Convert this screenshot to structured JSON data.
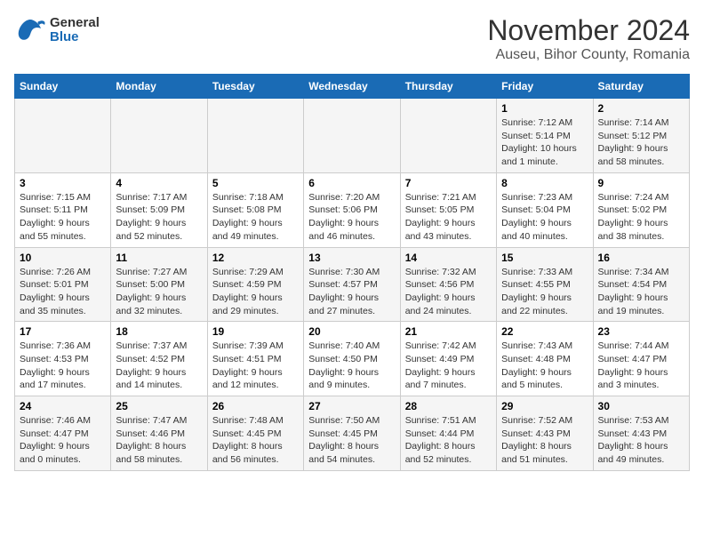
{
  "logo": {
    "line1": "General",
    "line2": "Blue"
  },
  "title": "November 2024",
  "location": "Auseu, Bihor County, Romania",
  "days_of_week": [
    "Sunday",
    "Monday",
    "Tuesday",
    "Wednesday",
    "Thursday",
    "Friday",
    "Saturday"
  ],
  "weeks": [
    [
      {
        "day": "",
        "info": ""
      },
      {
        "day": "",
        "info": ""
      },
      {
        "day": "",
        "info": ""
      },
      {
        "day": "",
        "info": ""
      },
      {
        "day": "",
        "info": ""
      },
      {
        "day": "1",
        "info": "Sunrise: 7:12 AM\nSunset: 5:14 PM\nDaylight: 10 hours and 1 minute."
      },
      {
        "day": "2",
        "info": "Sunrise: 7:14 AM\nSunset: 5:12 PM\nDaylight: 9 hours and 58 minutes."
      }
    ],
    [
      {
        "day": "3",
        "info": "Sunrise: 7:15 AM\nSunset: 5:11 PM\nDaylight: 9 hours and 55 minutes."
      },
      {
        "day": "4",
        "info": "Sunrise: 7:17 AM\nSunset: 5:09 PM\nDaylight: 9 hours and 52 minutes."
      },
      {
        "day": "5",
        "info": "Sunrise: 7:18 AM\nSunset: 5:08 PM\nDaylight: 9 hours and 49 minutes."
      },
      {
        "day": "6",
        "info": "Sunrise: 7:20 AM\nSunset: 5:06 PM\nDaylight: 9 hours and 46 minutes."
      },
      {
        "day": "7",
        "info": "Sunrise: 7:21 AM\nSunset: 5:05 PM\nDaylight: 9 hours and 43 minutes."
      },
      {
        "day": "8",
        "info": "Sunrise: 7:23 AM\nSunset: 5:04 PM\nDaylight: 9 hours and 40 minutes."
      },
      {
        "day": "9",
        "info": "Sunrise: 7:24 AM\nSunset: 5:02 PM\nDaylight: 9 hours and 38 minutes."
      }
    ],
    [
      {
        "day": "10",
        "info": "Sunrise: 7:26 AM\nSunset: 5:01 PM\nDaylight: 9 hours and 35 minutes."
      },
      {
        "day": "11",
        "info": "Sunrise: 7:27 AM\nSunset: 5:00 PM\nDaylight: 9 hours and 32 minutes."
      },
      {
        "day": "12",
        "info": "Sunrise: 7:29 AM\nSunset: 4:59 PM\nDaylight: 9 hours and 29 minutes."
      },
      {
        "day": "13",
        "info": "Sunrise: 7:30 AM\nSunset: 4:57 PM\nDaylight: 9 hours and 27 minutes."
      },
      {
        "day": "14",
        "info": "Sunrise: 7:32 AM\nSunset: 4:56 PM\nDaylight: 9 hours and 24 minutes."
      },
      {
        "day": "15",
        "info": "Sunrise: 7:33 AM\nSunset: 4:55 PM\nDaylight: 9 hours and 22 minutes."
      },
      {
        "day": "16",
        "info": "Sunrise: 7:34 AM\nSunset: 4:54 PM\nDaylight: 9 hours and 19 minutes."
      }
    ],
    [
      {
        "day": "17",
        "info": "Sunrise: 7:36 AM\nSunset: 4:53 PM\nDaylight: 9 hours and 17 minutes."
      },
      {
        "day": "18",
        "info": "Sunrise: 7:37 AM\nSunset: 4:52 PM\nDaylight: 9 hours and 14 minutes."
      },
      {
        "day": "19",
        "info": "Sunrise: 7:39 AM\nSunset: 4:51 PM\nDaylight: 9 hours and 12 minutes."
      },
      {
        "day": "20",
        "info": "Sunrise: 7:40 AM\nSunset: 4:50 PM\nDaylight: 9 hours and 9 minutes."
      },
      {
        "day": "21",
        "info": "Sunrise: 7:42 AM\nSunset: 4:49 PM\nDaylight: 9 hours and 7 minutes."
      },
      {
        "day": "22",
        "info": "Sunrise: 7:43 AM\nSunset: 4:48 PM\nDaylight: 9 hours and 5 minutes."
      },
      {
        "day": "23",
        "info": "Sunrise: 7:44 AM\nSunset: 4:47 PM\nDaylight: 9 hours and 3 minutes."
      }
    ],
    [
      {
        "day": "24",
        "info": "Sunrise: 7:46 AM\nSunset: 4:47 PM\nDaylight: 9 hours and 0 minutes."
      },
      {
        "day": "25",
        "info": "Sunrise: 7:47 AM\nSunset: 4:46 PM\nDaylight: 8 hours and 58 minutes."
      },
      {
        "day": "26",
        "info": "Sunrise: 7:48 AM\nSunset: 4:45 PM\nDaylight: 8 hours and 56 minutes."
      },
      {
        "day": "27",
        "info": "Sunrise: 7:50 AM\nSunset: 4:45 PM\nDaylight: 8 hours and 54 minutes."
      },
      {
        "day": "28",
        "info": "Sunrise: 7:51 AM\nSunset: 4:44 PM\nDaylight: 8 hours and 52 minutes."
      },
      {
        "day": "29",
        "info": "Sunrise: 7:52 AM\nSunset: 4:43 PM\nDaylight: 8 hours and 51 minutes."
      },
      {
        "day": "30",
        "info": "Sunrise: 7:53 AM\nSunset: 4:43 PM\nDaylight: 8 hours and 49 minutes."
      }
    ]
  ]
}
